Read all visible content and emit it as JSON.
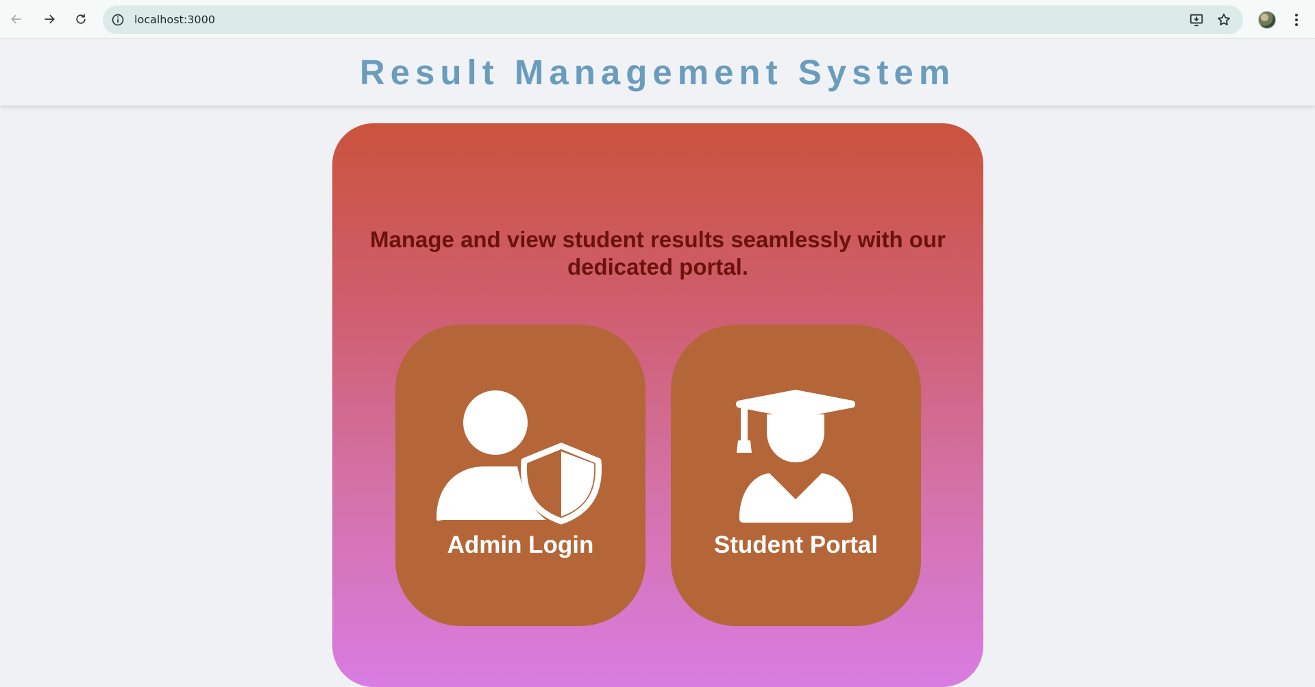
{
  "browser": {
    "url": "localhost:3000",
    "icons": {
      "back": "arrow-left-icon",
      "forward": "arrow-right-icon",
      "reload": "reload-icon",
      "site_info": "info-icon",
      "install": "install-app-icon",
      "bookmark": "star-icon",
      "menu": "kebab-menu-icon"
    }
  },
  "header": {
    "title": "Result Management System",
    "title_color": "#6a9cbc"
  },
  "main": {
    "tagline": "Manage and view student results seamlessly with our dedicated portal.",
    "tagline_color": "#6b120a",
    "gradient": [
      "#ca533c",
      "#d97ce2"
    ],
    "tile_color": "#b46638",
    "tiles": [
      {
        "label": "Admin Login",
        "icon": "user-shield-icon"
      },
      {
        "label": "Student Portal",
        "icon": "graduate-icon"
      }
    ]
  }
}
